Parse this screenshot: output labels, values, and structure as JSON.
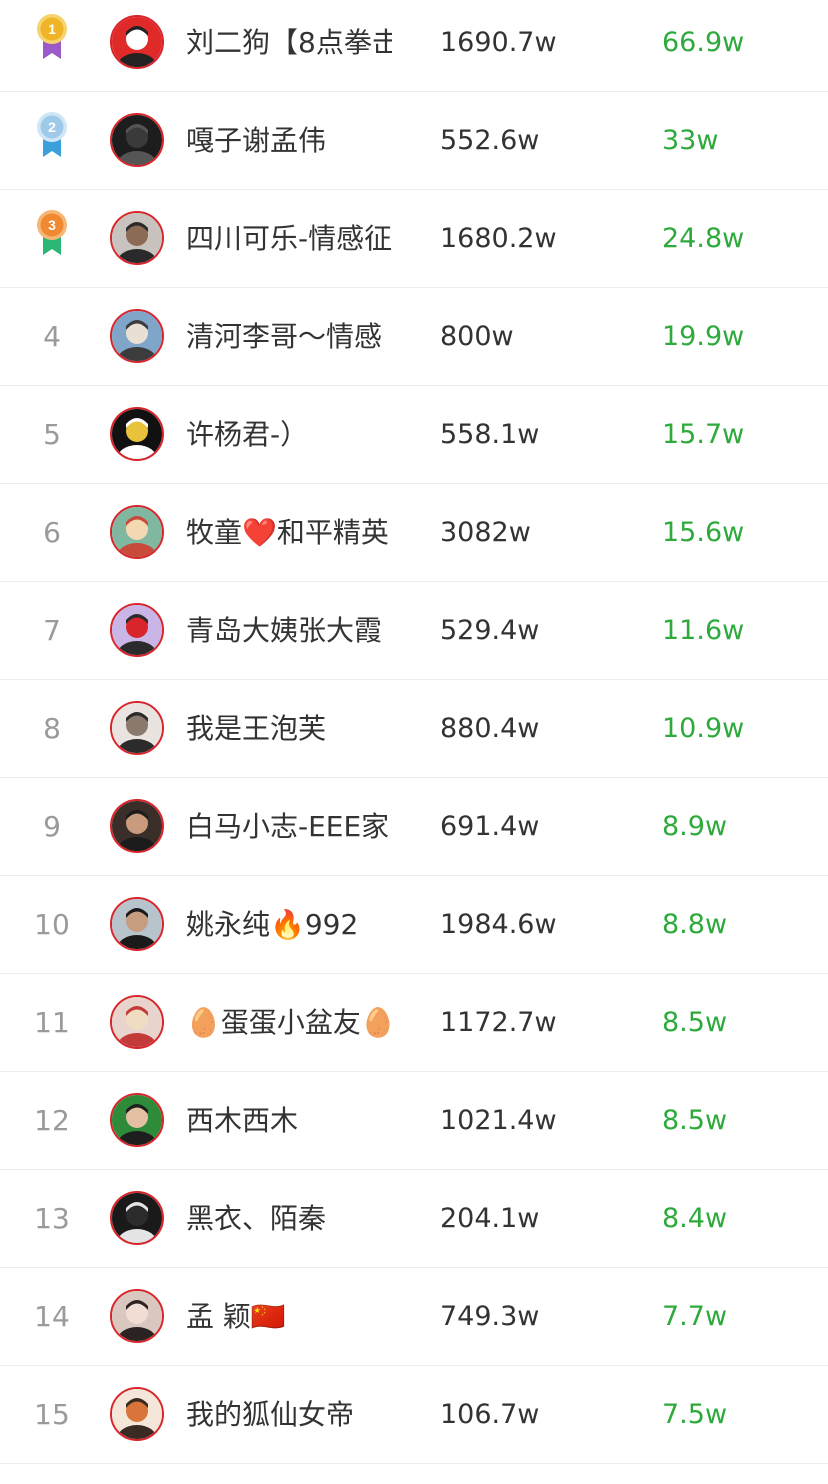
{
  "colors": {
    "gain_text": "#2eaa3c",
    "rank_text": "#9a9a9a",
    "avatar_border": "#d8242a",
    "divider": "#ececec",
    "medal_gold": "#f0b429",
    "medal_silver": "#9fc9e8",
    "medal_bronze": "#f0892f"
  },
  "rows": [
    {
      "rank": "1",
      "medal": "gold-medal-icon",
      "avatar": "avatar-red-logo",
      "name": "刘二狗【8点拳击",
      "fans": "1690.7w",
      "gain": "66.9w"
    },
    {
      "rank": "2",
      "medal": "silver-medal-icon",
      "avatar": "avatar-dark-portrait",
      "name": "嘎子谢孟伟",
      "fans": "552.6w",
      "gain": "33w"
    },
    {
      "rank": "3",
      "medal": "bronze-medal-icon",
      "avatar": "avatar-man-portrait",
      "name": "四川可乐-情感征",
      "fans": "1680.2w",
      "gain": "24.8w"
    },
    {
      "rank": "4",
      "medal": "",
      "avatar": "avatar-man-outdoor",
      "name": "清河李哥～情感",
      "fans": "800w",
      "gain": "19.9w"
    },
    {
      "rank": "5",
      "medal": "",
      "avatar": "avatar-dark-graphic",
      "name": "许杨君-）",
      "fans": "558.1w",
      "gain": "15.7w"
    },
    {
      "rank": "6",
      "medal": "",
      "avatar": "avatar-anime-girl",
      "name": "牧童❤️和平精英",
      "fans": "3082w",
      "gain": "15.6w"
    },
    {
      "rank": "7",
      "medal": "",
      "avatar": "avatar-woman-purple",
      "name": "青岛大姨张大霞",
      "fans": "529.4w",
      "gain": "11.6w"
    },
    {
      "rank": "8",
      "medal": "",
      "avatar": "avatar-cat",
      "name": "我是王泡芙",
      "fans": "880.4w",
      "gain": "10.9w"
    },
    {
      "rank": "9",
      "medal": "",
      "avatar": "avatar-man-closeup",
      "name": "白马小志-EEE家",
      "fans": "691.4w",
      "gain": "8.9w"
    },
    {
      "rank": "10",
      "medal": "",
      "avatar": "avatar-man-cap",
      "name": "姚永纯🔥992",
      "fans": "1984.6w",
      "gain": "8.8w"
    },
    {
      "rank": "11",
      "medal": "",
      "avatar": "avatar-woman-blonde",
      "name": "🥚蛋蛋小盆友🥚",
      "fans": "1172.7w",
      "gain": "8.5w"
    },
    {
      "rank": "12",
      "medal": "",
      "avatar": "avatar-man-green",
      "name": "西木西木",
      "fans": "1021.4w",
      "gain": "8.5w"
    },
    {
      "rank": "13",
      "medal": "",
      "avatar": "avatar-black-character",
      "name": "黑衣、陌秦",
      "fans": "204.1w",
      "gain": "8.4w"
    },
    {
      "rank": "14",
      "medal": "",
      "avatar": "avatar-woman-portrait",
      "name": "孟 颖🇨🇳",
      "fans": "749.3w",
      "gain": "7.7w"
    },
    {
      "rank": "15",
      "medal": "",
      "avatar": "avatar-fox-cartoon",
      "name": "我的狐仙女帝",
      "fans": "106.7w",
      "gain": "7.5w"
    }
  ]
}
